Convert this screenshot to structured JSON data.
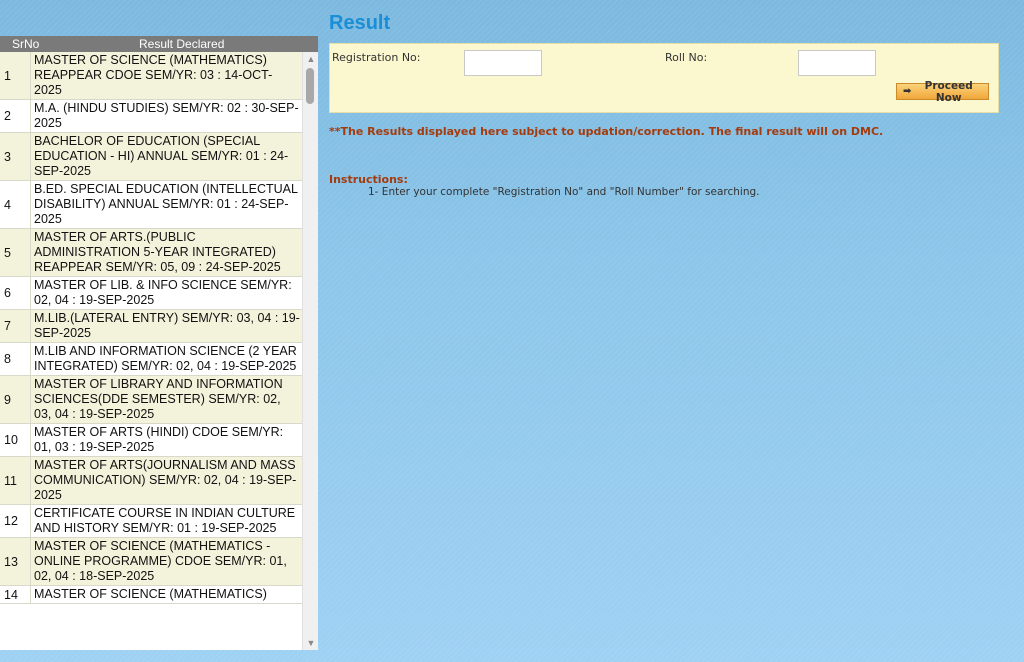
{
  "page": {
    "title": "Result"
  },
  "list": {
    "header": {
      "srno": "SrNo",
      "result": "Result Declared"
    },
    "rows": [
      {
        "sr": "1",
        "text": "MASTER OF SCIENCE (MATHEMATICS) REAPPEAR CDOE SEM/YR: 03 : 14-OCT-2025"
      },
      {
        "sr": "2",
        "text": "M.A. (HINDU STUDIES) SEM/YR: 02 : 30-SEP-2025"
      },
      {
        "sr": "3",
        "text": "BACHELOR OF EDUCATION (SPECIAL EDUCATION - HI) ANNUAL SEM/YR: 01 : 24-SEP-2025"
      },
      {
        "sr": "4",
        "text": "B.ED. SPECIAL EDUCATION (INTELLECTUAL DISABILITY) ANNUAL SEM/YR: 01 : 24-SEP-2025"
      },
      {
        "sr": "5",
        "text": "MASTER OF ARTS.(PUBLIC ADMINISTRATION 5-YEAR INTEGRATED) REAPPEAR SEM/YR: 05, 09 : 24-SEP-2025"
      },
      {
        "sr": "6",
        "text": "MASTER OF LIB. & INFO SCIENCE SEM/YR: 02, 04 : 19-SEP-2025"
      },
      {
        "sr": "7",
        "text": "M.LIB.(LATERAL ENTRY) SEM/YR: 03, 04 : 19-SEP-2025"
      },
      {
        "sr": "8",
        "text": "M.LIB AND INFORMATION SCIENCE (2 YEAR INTEGRATED) SEM/YR: 02, 04 : 19-SEP-2025"
      },
      {
        "sr": "9",
        "text": "MASTER OF LIBRARY AND INFORMATION SCIENCES(DDE SEMESTER) SEM/YR: 02, 03, 04 : 19-SEP-2025"
      },
      {
        "sr": "10",
        "text": "MASTER OF ARTS (HINDI) CDOE SEM/YR: 01, 03 : 19-SEP-2025"
      },
      {
        "sr": "11",
        "text": "MASTER OF ARTS(JOURNALISM AND MASS COMMUNICATION) SEM/YR: 02, 04 : 19-SEP-2025"
      },
      {
        "sr": "12",
        "text": "CERTIFICATE COURSE IN INDIAN CULTURE AND HISTORY SEM/YR: 01 : 19-SEP-2025"
      },
      {
        "sr": "13",
        "text": "MASTER OF SCIENCE (MATHEMATICS - ONLINE PROGRAMME) CDOE SEM/YR: 01, 02, 04 : 18-SEP-2025"
      },
      {
        "sr": "14",
        "text": "MASTER OF SCIENCE (MATHEMATICS)"
      }
    ]
  },
  "form": {
    "registration_label": "Registration No:",
    "registration_value": "",
    "roll_label": "Roll No:",
    "roll_value": "",
    "proceed_label": "Proceed Now"
  },
  "notice": "**The Results displayed here subject to updation/correction. The final result will on DMC.",
  "instructions": {
    "title": "Instructions:",
    "line1": "1- Enter your complete \"Registration No\" and \"Roll Number\" for searching."
  },
  "colors": {
    "title": "#1a8ed6",
    "notice": "#a53b0d",
    "form_bg": "#fbf7cf",
    "row_alt": "#f3f3dc"
  },
  "icons": {
    "proceed": "arrow-right-icon",
    "scroll_up": "chevron-up-icon",
    "scroll_down": "chevron-down-icon"
  }
}
